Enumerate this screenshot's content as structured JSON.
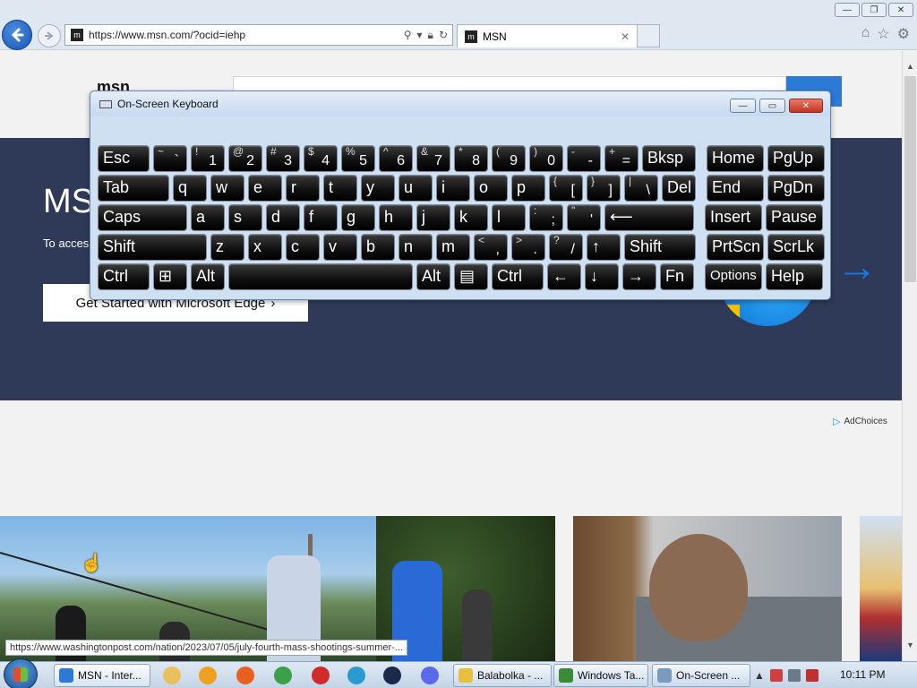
{
  "browser": {
    "url": "https://www.msn.com/?ocid=iehp",
    "tab_title": "MSN",
    "tab_close": "✕",
    "favicon": "m"
  },
  "page": {
    "logo_text": "msn",
    "hero_title": "MS",
    "hero_subtitle": "To acces",
    "edge_button_label": "Get Started with Microsoft Edge",
    "edge_button_chevron": "›",
    "adchoices_label": "AdChoices",
    "status_url": "https://www.washingtonpost.com/nation/2023/07/05/july-fourth-mass-shootings-summer-..."
  },
  "osk": {
    "title": "On-Screen Keyboard",
    "min": "—",
    "max": "▭",
    "close": "✕",
    "rows": [
      [
        {
          "m": "Esc",
          "w": 58
        },
        {
          "s": "~",
          "b": "`",
          "w": 38
        },
        {
          "s": "!",
          "b": "1",
          "w": 38
        },
        {
          "s": "@",
          "b": "2",
          "w": 38
        },
        {
          "s": "#",
          "b": "3",
          "w": 38
        },
        {
          "s": "$",
          "b": "4",
          "w": 38
        },
        {
          "s": "%",
          "b": "5",
          "w": 38
        },
        {
          "s": "^",
          "b": "6",
          "w": 38
        },
        {
          "s": "&",
          "b": "7",
          "w": 38
        },
        {
          "s": "*",
          "b": "8",
          "w": 38
        },
        {
          "s": "(",
          "b": "9",
          "w": 38
        },
        {
          "s": ")",
          "b": "0",
          "w": 38
        },
        {
          "s": "-",
          "b": "-",
          "w": 38
        },
        {
          "s": "+",
          "b": "=",
          "w": 38
        },
        {
          "m": "Bksp",
          "w": 60
        },
        {
          "gap": 8
        },
        {
          "m": "Home",
          "w": 64
        },
        {
          "m": "PgUp",
          "w": 64
        }
      ],
      [
        {
          "m": "Tab",
          "w": 80
        },
        {
          "m": "q",
          "w": 38
        },
        {
          "m": "w",
          "w": 38
        },
        {
          "m": "e",
          "w": 38
        },
        {
          "m": "r",
          "w": 38
        },
        {
          "m": "t",
          "w": 38
        },
        {
          "m": "y",
          "w": 38
        },
        {
          "m": "u",
          "w": 38
        },
        {
          "m": "i",
          "w": 38
        },
        {
          "m": "o",
          "w": 38
        },
        {
          "m": "p",
          "w": 38
        },
        {
          "s": "{",
          "b": "[",
          "w": 38
        },
        {
          "s": "}",
          "b": "]",
          "w": 38
        },
        {
          "s": "|",
          "b": "\\",
          "w": 38
        },
        {
          "m": "Del",
          "w": 38
        },
        {
          "gap": 8
        },
        {
          "m": "End",
          "w": 64
        },
        {
          "m": "PgDn",
          "w": 64
        }
      ],
      [
        {
          "m": "Caps",
          "w": 100
        },
        {
          "m": "a",
          "w": 38
        },
        {
          "m": "s",
          "w": 38
        },
        {
          "m": "d",
          "w": 38
        },
        {
          "m": "f",
          "w": 38
        },
        {
          "m": "g",
          "w": 38
        },
        {
          "m": "h",
          "w": 38
        },
        {
          "m": "j",
          "w": 38
        },
        {
          "m": "k",
          "w": 38
        },
        {
          "m": "l",
          "w": 38
        },
        {
          "s": ":",
          "b": ";",
          "w": 38
        },
        {
          "s": "\"",
          "b": "'",
          "w": 38
        },
        {
          "m": "⟵",
          "w": 100
        },
        {
          "gap": 8
        },
        {
          "m": "Insert",
          "w": 64
        },
        {
          "m": "Pause",
          "w": 64
        }
      ],
      [
        {
          "m": "Shift",
          "w": 122
        },
        {
          "m": "z",
          "w": 38
        },
        {
          "m": "x",
          "w": 38
        },
        {
          "m": "c",
          "w": 38
        },
        {
          "m": "v",
          "w": 38
        },
        {
          "m": "b",
          "w": 38
        },
        {
          "m": "n",
          "w": 38
        },
        {
          "m": "m",
          "w": 38
        },
        {
          "s": "<",
          "b": ",",
          "w": 38
        },
        {
          "s": ">",
          "b": ".",
          "w": 38
        },
        {
          "s": "?",
          "b": "/",
          "w": 38
        },
        {
          "m": "↑",
          "w": 38
        },
        {
          "m": "Shift",
          "w": 80
        },
        {
          "gap": 8
        },
        {
          "m": "PrtScn",
          "w": 64
        },
        {
          "m": "ScrLk",
          "w": 64
        }
      ],
      [
        {
          "m": "Ctrl",
          "w": 58
        },
        {
          "m": "⊞",
          "w": 38
        },
        {
          "m": "Alt",
          "w": 38
        },
        {
          "m": "",
          "w": 206
        },
        {
          "m": "Alt",
          "w": 38
        },
        {
          "m": "▤",
          "w": 38
        },
        {
          "m": "Ctrl",
          "w": 58
        },
        {
          "m": "←",
          "w": 38
        },
        {
          "m": "↓",
          "w": 38
        },
        {
          "m": "→",
          "w": 38
        },
        {
          "m": "Fn",
          "w": 38
        },
        {
          "gap": 8
        },
        {
          "m": "Options",
          "w": 64,
          "small": true
        },
        {
          "m": "Help",
          "w": 64
        }
      ]
    ]
  },
  "taskbar": {
    "items": [
      {
        "label": "MSN - Inter...",
        "icon_color": "#2a7ad6",
        "active": true
      },
      {
        "label": "Balabolka - ...",
        "icon_color": "#e8c040",
        "active": false
      },
      {
        "label": "Windows Ta...",
        "icon_color": "#3a8a3a",
        "active": false
      },
      {
        "label": "On-Screen ...",
        "icon_color": "#7a9ac0",
        "active": false
      }
    ],
    "pinned": [
      {
        "name": "folder-icon",
        "color": "#e8c060"
      },
      {
        "name": "media-player-icon",
        "color": "#f0a020"
      },
      {
        "name": "firefox-icon",
        "color": "#e86020"
      },
      {
        "name": "chrome-icon",
        "color": "#3aa04a"
      },
      {
        "name": "app-red-icon",
        "color": "#d02a2a"
      },
      {
        "name": "app-blue-icon",
        "color": "#2a9ad0"
      },
      {
        "name": "steam-icon",
        "color": "#1a2a4a"
      },
      {
        "name": "discord-icon",
        "color": "#5a6ae8"
      }
    ],
    "tray_arrow": "▲",
    "clock": "10:11 PM"
  }
}
